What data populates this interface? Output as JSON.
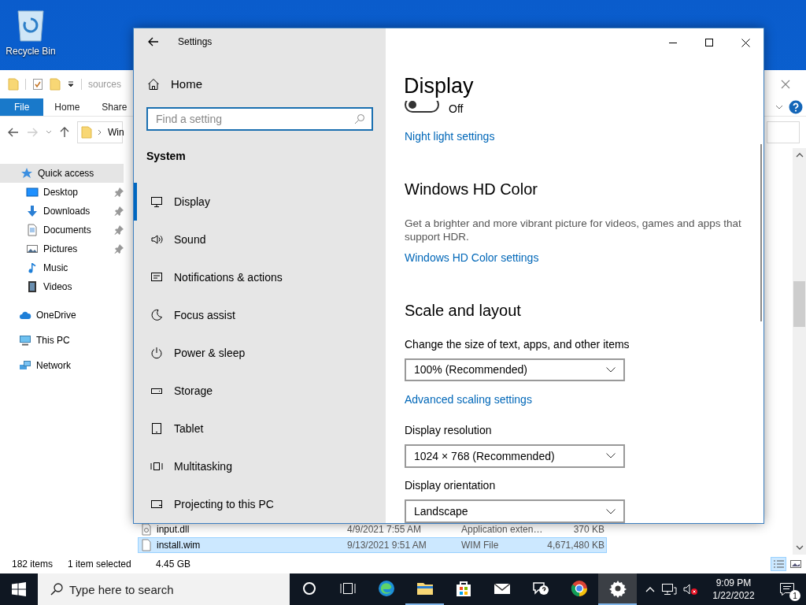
{
  "desktop_icons": [
    {
      "label": "Recycle Bin"
    }
  ],
  "explorer": {
    "quick_access_path": "sources",
    "ribbon_tabs": [
      {
        "label": "File",
        "selected": true
      },
      {
        "label": "Home",
        "selected": false
      },
      {
        "label": "Share",
        "selected": false
      }
    ],
    "address": "Win",
    "nav_tree": [
      {
        "label": "Quick access",
        "kind": "star",
        "selected": true,
        "children": [
          {
            "label": "Desktop",
            "kind": "desktop",
            "pinned": true
          },
          {
            "label": "Downloads",
            "kind": "downloads",
            "pinned": true
          },
          {
            "label": "Documents",
            "kind": "documents",
            "pinned": true
          },
          {
            "label": "Pictures",
            "kind": "pictures",
            "pinned": true
          },
          {
            "label": "Music",
            "kind": "music",
            "pinned": false
          },
          {
            "label": "Videos",
            "kind": "videos",
            "pinned": false
          }
        ]
      },
      {
        "label": "OneDrive",
        "kind": "cloud",
        "selected": false
      },
      {
        "label": "This PC",
        "kind": "pc",
        "selected": false
      },
      {
        "label": "Network",
        "kind": "network",
        "selected": false
      }
    ],
    "files": [
      {
        "name": "input.dll",
        "kind": "dll",
        "date": "4/9/2021 7:55 AM",
        "type": "Application exten…",
        "size": "370 KB",
        "selected": false
      },
      {
        "name": "install.wim",
        "kind": "file",
        "date": "9/13/2021 9:51 AM",
        "type": "WIM File",
        "size": "4,671,480 KB",
        "selected": true
      }
    ],
    "status_bar": {
      "item_count": "182 items",
      "selection": "1 item selected",
      "selection_size": "4.45 GB"
    }
  },
  "settings": {
    "title": "Settings",
    "home": "Home",
    "search": {
      "placeholder": "Find a setting"
    },
    "section": "System",
    "nav_items": [
      {
        "label": "Display",
        "kind": "display",
        "selected": true
      },
      {
        "label": "Sound",
        "kind": "sound",
        "selected": false
      },
      {
        "label": "Notifications & actions",
        "kind": "notifications",
        "selected": false
      },
      {
        "label": "Focus assist",
        "kind": "focus",
        "selected": false
      },
      {
        "label": "Power & sleep",
        "kind": "power",
        "selected": false
      },
      {
        "label": "Storage",
        "kind": "storage",
        "selected": false
      },
      {
        "label": "Tablet",
        "kind": "tablet",
        "selected": false
      },
      {
        "label": "Multitasking",
        "kind": "multitasking",
        "selected": false
      },
      {
        "label": "Projecting to this PC",
        "kind": "projecting",
        "selected": false
      }
    ],
    "page_title": "Display",
    "content": [
      {
        "kind": "toggle",
        "on": false,
        "text": "Off"
      },
      {
        "kind": "link",
        "text": "Night light settings"
      },
      {
        "kind": "heading",
        "text": "Windows HD Color"
      },
      {
        "kind": "text",
        "text": "Get a brighter and more vibrant picture for videos, games and apps that support HDR."
      },
      {
        "kind": "link",
        "text": "Windows HD Color settings"
      },
      {
        "kind": "heading",
        "text": "Scale and layout"
      },
      {
        "kind": "label",
        "text": "Change the size of text, apps, and other items"
      },
      {
        "kind": "dropdown",
        "text": "100% (Recommended)"
      },
      {
        "kind": "link",
        "text": "Advanced scaling settings"
      },
      {
        "kind": "label",
        "text": "Display resolution"
      },
      {
        "kind": "dropdown",
        "text": "1024 × 768 (Recommended)"
      },
      {
        "kind": "label",
        "text": "Display orientation"
      },
      {
        "kind": "dropdown",
        "text": "Landscape"
      }
    ]
  },
  "taskbar": {
    "search": {
      "placeholder": "Type here to search"
    },
    "apps": [
      {
        "kind": "cortana",
        "open": false,
        "selected": false
      },
      {
        "kind": "taskview",
        "open": false,
        "selected": false
      },
      {
        "kind": "edge",
        "open": false,
        "selected": false
      },
      {
        "kind": "explorer",
        "open": true,
        "selected": false
      },
      {
        "kind": "store",
        "open": false,
        "selected": false
      },
      {
        "kind": "mail",
        "open": false,
        "selected": false
      },
      {
        "kind": "feedback",
        "open": false,
        "selected": false
      },
      {
        "kind": "chrome",
        "open": false,
        "selected": false
      },
      {
        "kind": "settings",
        "open": true,
        "selected": true
      }
    ],
    "tray": {
      "volume_muted": true,
      "time": "9:09 PM",
      "date": "1/22/2022",
      "notification_count": "1"
    }
  }
}
